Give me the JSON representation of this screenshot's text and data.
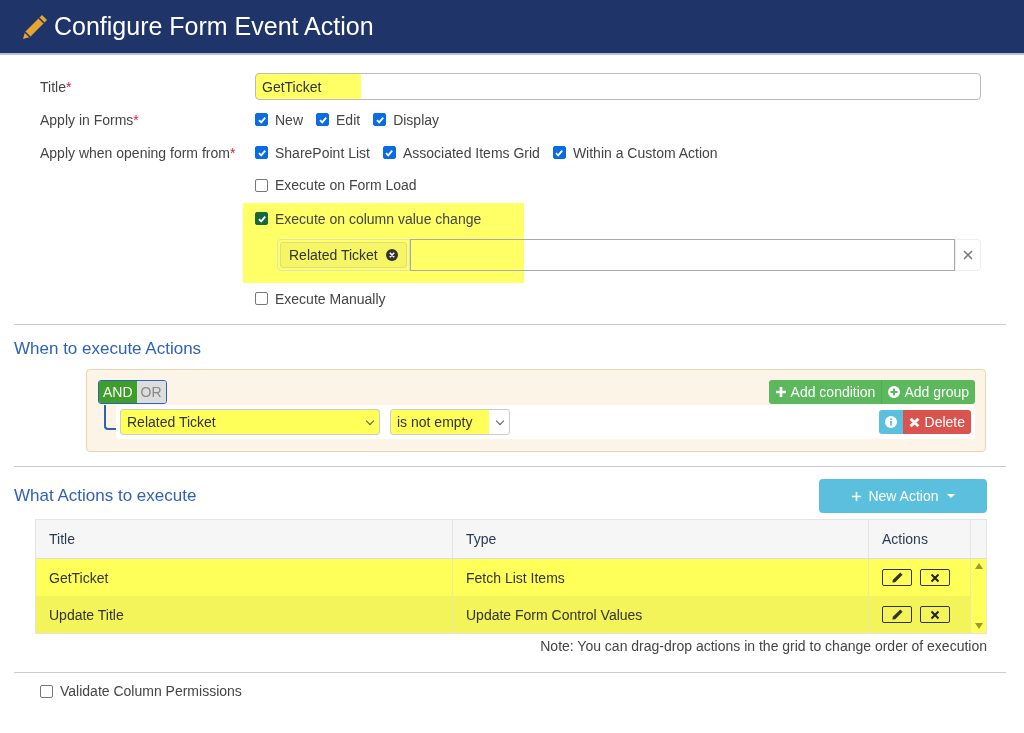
{
  "window": {
    "title": "Configure Form Event Action"
  },
  "form": {
    "title_field": {
      "label": "Title",
      "required_mark": "*",
      "value": "GetTicket",
      "highlighted": true
    },
    "apply_in_forms": {
      "label": "Apply in Forms",
      "required_mark": "*",
      "options": [
        {
          "label": "New",
          "checked": true
        },
        {
          "label": "Edit",
          "checked": true
        },
        {
          "label": "Display",
          "checked": true
        }
      ]
    },
    "apply_from": {
      "label": "Apply when opening form from",
      "required_mark": "*",
      "options": [
        {
          "label": "SharePoint List",
          "checked": true
        },
        {
          "label": "Associated Items Grid",
          "checked": true
        },
        {
          "label": "Within a Custom Action",
          "checked": true
        }
      ]
    },
    "triggers": [
      {
        "label": "Execute on Form Load",
        "checked": false,
        "highlighted": false
      },
      {
        "label": "Execute on column value change",
        "checked": true,
        "highlighted": true,
        "columns": [
          "Related Ticket"
        ]
      },
      {
        "label": "Execute Manually",
        "checked": false,
        "highlighted": false
      }
    ]
  },
  "conditions": {
    "heading": "When to execute Actions",
    "logic": [
      {
        "label": "AND",
        "selected": true
      },
      {
        "label": "OR",
        "selected": false
      }
    ],
    "add_condition": "Add condition",
    "add_group": "Add group",
    "rules": [
      {
        "field": "Related Ticket",
        "operator": "is not empty",
        "delete": "Delete",
        "highlighted": true
      }
    ]
  },
  "actions": {
    "heading": "What Actions to execute",
    "new_action": "New Action",
    "columns": [
      "Title",
      "Type",
      "Actions"
    ],
    "rows": [
      {
        "title": "GetTicket",
        "type": "Fetch List Items",
        "highlighted": true
      },
      {
        "title": "Update Title",
        "type": "Update Form Control Values",
        "highlighted": true
      }
    ],
    "note": "Note: You can drag-drop actions in the grid to change order of execution"
  },
  "validate": {
    "label": "Validate Column Permissions",
    "checked": false
  }
}
